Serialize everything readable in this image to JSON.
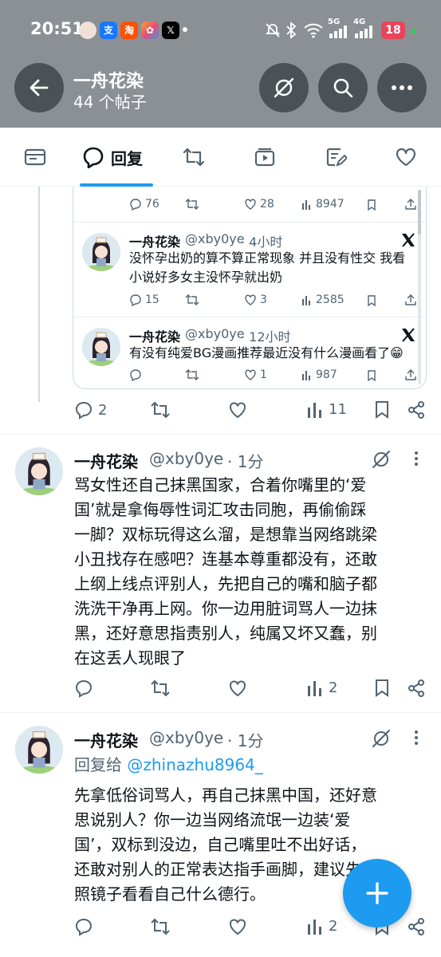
{
  "status_bar": {
    "time": "20:51",
    "net_5g": "5G",
    "net_4g": "4G",
    "battery": "18",
    "app_icons": [
      "avatar-app",
      "alipay-icon",
      "taobao-icon",
      "photos-app-icon",
      "x-app-icon"
    ],
    "colors": {
      "bar": "#8a9094",
      "battery": "#e9445a"
    }
  },
  "header": {
    "title": "一舟花染",
    "subtitle": "44 个帖子"
  },
  "tabs": [
    {
      "name": "posts",
      "label": ""
    },
    {
      "name": "replies",
      "label": "回复",
      "active": true
    },
    {
      "name": "reposts",
      "label": ""
    },
    {
      "name": "media",
      "label": ""
    },
    {
      "name": "articles",
      "label": ""
    },
    {
      "name": "likes",
      "label": ""
    }
  ],
  "quoted_card": {
    "top_stats": {
      "replies": "76",
      "likes": "28",
      "views": "8947"
    },
    "posts": [
      {
        "name": "一舟花染",
        "handle": "@xby0ye",
        "time": "· 4小时",
        "text_line1": "没怀孕出奶的算不算正常现象 并且没有性交 我看",
        "text_line2": "小说好多女主没怀孕就出奶",
        "stats": {
          "replies": "15",
          "likes": "3",
          "views": "2585"
        }
      },
      {
        "name": "一舟花染",
        "handle": "@xby0ye",
        "time": "· 12小时",
        "text_line1": "有没有纯爱BG漫画推荐最近没有什么漫画看了😁",
        "stats": {
          "replies": "0",
          "likes": "1",
          "views": "987"
        }
      }
    ]
  },
  "parent_actions": {
    "replies": "2",
    "views": "11"
  },
  "tweets": [
    {
      "name": "一舟花染",
      "handle": "@xby0ye",
      "time": "· 1分",
      "lines": [
        "骂女性还自己抹黑国家，合着你嘴里的‘爱",
        "国’就是拿侮辱性词汇攻击同胞，再偷偷踩",
        "一脚？双标玩得这么溜，是想靠当网络跳梁",
        "小丑找存在感吧？连基本尊重都没有，还敢",
        "上纲上线点评别人，先把自己的嘴和脑子都",
        "洗洗干净再上网。你一边用脏词骂人一边抹",
        "黑，还好意思指责别人，纯属又坏又蠢，别",
        "在这丢人现眼了"
      ],
      "views": "2"
    },
    {
      "name": "一舟花染",
      "handle": "@xby0ye",
      "time": "· 1分",
      "reply_prefix": "回复给",
      "reply_handle": "@zhinazhu8964_",
      "lines": [
        "先拿低俗词骂人，再自己抹黑中国，还好意",
        "思说别人？你一边当网络流氓一边装‘爱",
        "国’，双标到没边，自己嘴里吐不出好话，",
        "还敢对别人的正常表达指手画脚，建议先照",
        "照镜子看看自己什么德行。"
      ],
      "views": "2"
    }
  ],
  "accent": "#1d9bf0"
}
